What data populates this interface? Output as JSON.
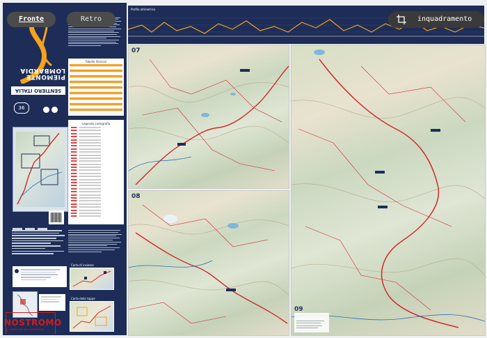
{
  "toolbar": {
    "front_label": "Fronte",
    "back_label": "Retro",
    "frame_label": "inquadramento",
    "frame_icon": "crop-frame-icon"
  },
  "cover": {
    "brand": "SENTIERO ITALIA CAI",
    "title_line1": "PIEMONTE",
    "title_line2": "LOMBARDIA",
    "sheet_number": "36",
    "legend_title": "Legenda cartografia",
    "table_title": "Tabella itinerari",
    "route_thumbs_label_1": "Carta di insieme",
    "route_thumbs_label_2": "Carta delle tappe"
  },
  "profile": {
    "title": "Profilo altimetrico"
  },
  "map_panels": [
    {
      "number": "07"
    },
    {
      "number": "08"
    },
    {
      "number": "09"
    }
  ],
  "watermark": {
    "name": "NOSTROMO",
    "tagline": "IL COMPTOIR DES VOYAGEURS"
  },
  "colors": {
    "navy": "#1d2d57",
    "orange": "#f6a21c",
    "route_red": "#d02a2a",
    "watermark_red": "#d11d1d"
  }
}
